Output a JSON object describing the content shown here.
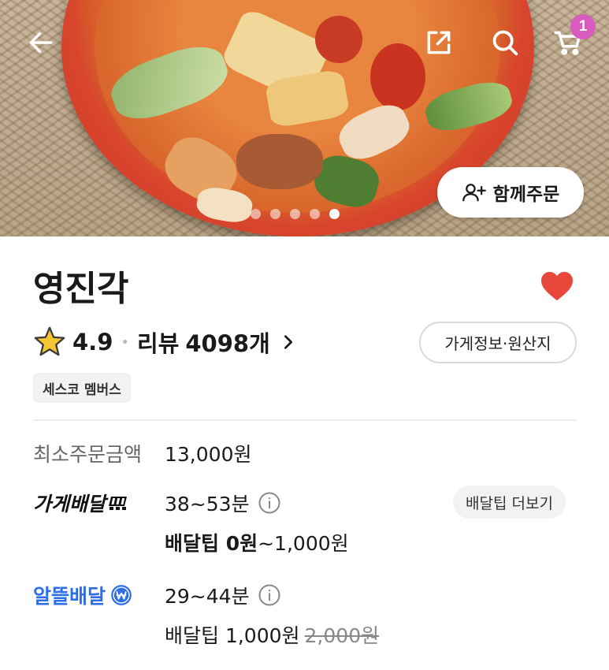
{
  "header": {
    "cart_badge_count": "1",
    "group_order_label": "함께주문",
    "carousel": {
      "total": 5,
      "active_index": 4
    },
    "icons": [
      "back-icon",
      "share-icon",
      "search-icon",
      "cart-icon"
    ]
  },
  "store": {
    "name": "영진각",
    "favorited": true,
    "rating": "4.9",
    "review_label": "리뷰",
    "review_count": "4098개",
    "info_button_label": "가게정보·원산지",
    "member_tag": "세스코 멤버스"
  },
  "order_info": {
    "min_order_label": "최소주문금액",
    "min_order_value": "13,000원",
    "store_delivery": {
      "label": "가게배달",
      "time": "38~53분",
      "tip_more_label": "배달팁 더보기",
      "tip_prefix": "배달팁 0원",
      "tip_suffix": "~1,000원"
    },
    "saver_delivery": {
      "label": "알뜰배달",
      "time": "29~44분",
      "tip": "배달팁 1,000원",
      "tip_original": "2,000원"
    }
  },
  "colors": {
    "accent_blue": "#2d6ee6",
    "heart_red": "#e8473b",
    "badge_pink": "#d95bbf",
    "star_yellow": "#f7c531"
  }
}
